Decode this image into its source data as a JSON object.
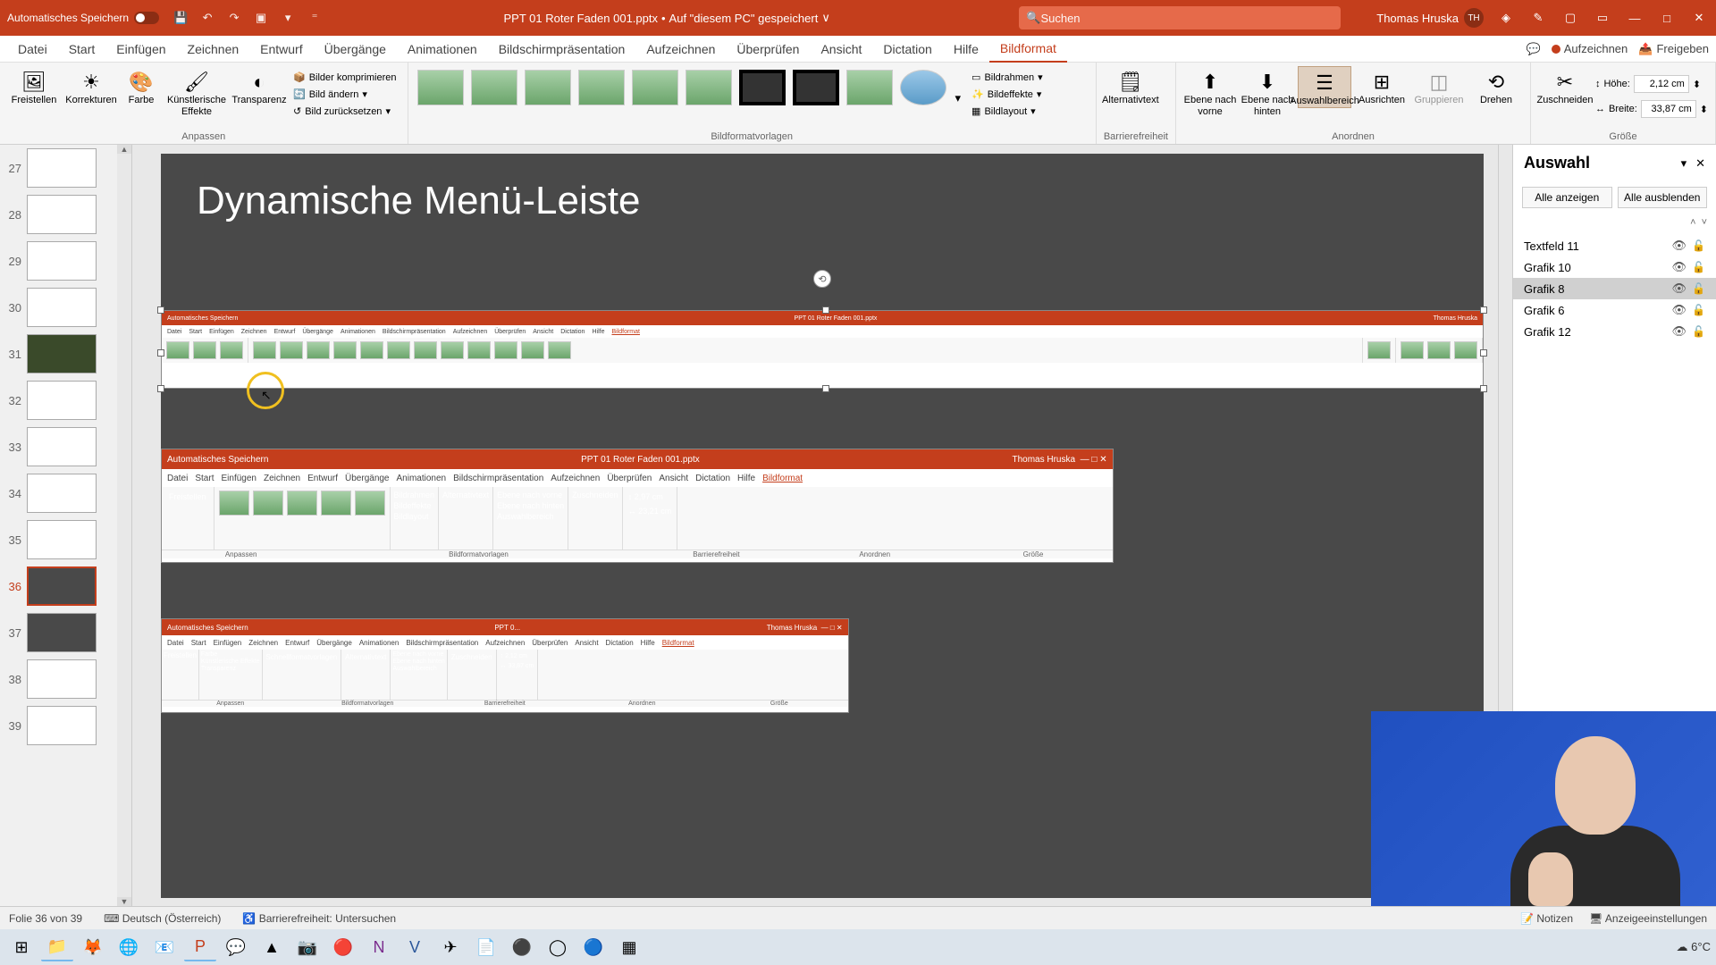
{
  "titlebar": {
    "autosave": "Automatisches Speichern",
    "filename": "PPT 01 Roter Faden 001.pptx",
    "save_status": "Auf \"diesem PC\" gespeichert",
    "search_placeholder": "Suchen",
    "user_name": "Thomas Hruska",
    "user_initials": "TH"
  },
  "menu": {
    "items": [
      "Datei",
      "Start",
      "Einfügen",
      "Zeichnen",
      "Entwurf",
      "Übergänge",
      "Animationen",
      "Bildschirmpräsentation",
      "Aufzeichnen",
      "Überprüfen",
      "Ansicht",
      "Dictation",
      "Hilfe",
      "Bildformat"
    ],
    "record": "Aufzeichnen",
    "share": "Freigeben"
  },
  "ribbon": {
    "freistellen": "Freistellen",
    "korrekturen": "Korrekturen",
    "farbe": "Farbe",
    "kuenstlerische": "Künstlerische Effekte",
    "transparenz": "Transparenz",
    "komprimieren": "Bilder komprimieren",
    "aendern": "Bild ändern",
    "zuruecksetzen": "Bild zurücksetzen",
    "anpassen": "Anpassen",
    "vorlagen": "Bildformatvorlagen",
    "bildrahmen": "Bildrahmen",
    "bildeffekte": "Bildeffekte",
    "bildlayout": "Bildlayout",
    "alternativtext": "Alternativtext",
    "barrierefreiheit": "Barrierefreiheit",
    "vorne": "Ebene nach vorne",
    "hinten": "Ebene nach hinten",
    "auswahlbereich": "Auswahlbereich",
    "ausrichten": "Ausrichten",
    "gruppieren": "Gruppieren",
    "drehen": "Drehen",
    "anordnen": "Anordnen",
    "zuschneiden": "Zuschneiden",
    "hoehe_lbl": "Höhe:",
    "breite_lbl": "Breite:",
    "hoehe": "2,12 cm",
    "breite": "33,87 cm",
    "groesse": "Größe"
  },
  "thumbs": [
    {
      "n": 27
    },
    {
      "n": 28
    },
    {
      "n": 29
    },
    {
      "n": 30
    },
    {
      "n": 31
    },
    {
      "n": 32
    },
    {
      "n": 33
    },
    {
      "n": 34
    },
    {
      "n": 35
    },
    {
      "n": 36,
      "sel": true
    },
    {
      "n": 37
    },
    {
      "n": 38
    },
    {
      "n": 39
    }
  ],
  "slide": {
    "title": "Dynamische Menü-Leiste"
  },
  "selpane": {
    "title": "Auswahl",
    "show_all": "Alle anzeigen",
    "hide_all": "Alle ausblenden",
    "items": [
      {
        "name": "Textfeld 11"
      },
      {
        "name": "Grafik 10"
      },
      {
        "name": "Grafik 8",
        "sel": true
      },
      {
        "name": "Grafik 6"
      },
      {
        "name": "Grafik 12"
      }
    ]
  },
  "status": {
    "slide": "Folie 36 von 39",
    "lang": "Deutsch (Österreich)",
    "access": "Barrierefreiheit: Untersuchen",
    "notes": "Notizen",
    "display": "Anzeigeeinstellungen"
  },
  "taskbar": {
    "weather": "6°C"
  },
  "embed": {
    "tabs": [
      "Datei",
      "Start",
      "Einfügen",
      "Zeichnen",
      "Entwurf",
      "Übergänge",
      "Animationen",
      "Bildschirmpräsentation",
      "Aufzeichnen",
      "Überprüfen",
      "Ansicht",
      "Dictation",
      "Hilfe",
      "Bildformat"
    ],
    "height2": "2,97 cm",
    "width2": "23,21 cm",
    "height3": "2,12 cm",
    "width3": "33,87 cm"
  }
}
